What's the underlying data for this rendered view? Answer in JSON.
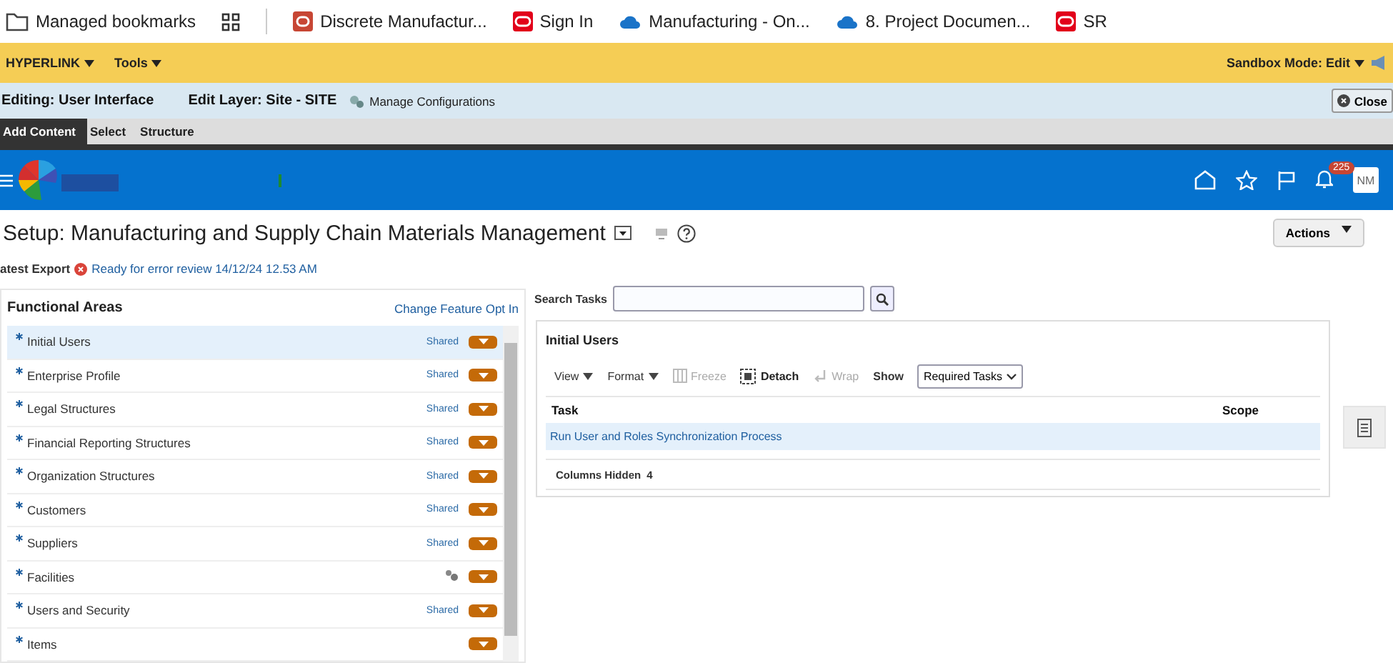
{
  "bookmarks": [
    {
      "kind": "folder",
      "label": "Managed bookmarks"
    },
    {
      "kind": "apps"
    },
    {
      "kind": "redsquare",
      "label": "Discrete Manufactur..."
    },
    {
      "kind": "oracle",
      "label": "Sign In"
    },
    {
      "kind": "cloud",
      "label": "Manufacturing - On..."
    },
    {
      "kind": "cloud",
      "label": "8. Project Documen..."
    },
    {
      "kind": "oracle",
      "label": "SR"
    }
  ],
  "menu_bar": {
    "menus": [
      "HYPERLINK",
      "Tools"
    ],
    "sandbox": "Sandbox Mode: Edit"
  },
  "edit_bar": {
    "editing": "Editing: User Interface",
    "layer": "Edit Layer: Site - SITE",
    "manage": "Manage Configurations",
    "close": "Close"
  },
  "composer_tabs": [
    {
      "label": "Add Content",
      "selected": true
    },
    {
      "label": "Select",
      "selected": false
    },
    {
      "label": "Structure",
      "selected": false
    }
  ],
  "header": {
    "notifications": "225",
    "avatar": "NM"
  },
  "page": {
    "title": "Setup: Manufacturing and Supply Chain Materials Management",
    "actions": "Actions",
    "export_label": "atest Export",
    "export_status": "Ready for error review 14/12/24 12.53 AM"
  },
  "functional_areas": {
    "title": "Functional Areas",
    "link": "Change Feature Opt In",
    "items": [
      {
        "label": "Initial Users",
        "required": true,
        "kind": "shared",
        "status": "Shared",
        "selected": true
      },
      {
        "label": "Enterprise Profile",
        "required": true,
        "kind": "shared",
        "status": "Shared",
        "selected": false
      },
      {
        "label": "Legal Structures",
        "required": true,
        "kind": "shared",
        "status": "Shared",
        "selected": false
      },
      {
        "label": "Financial Reporting Structures",
        "required": true,
        "kind": "shared",
        "status": "Shared",
        "selected": false
      },
      {
        "label": "Organization Structures",
        "required": true,
        "kind": "shared",
        "status": "Shared",
        "selected": false
      },
      {
        "label": "Customers",
        "required": true,
        "kind": "shared",
        "status": "Shared",
        "selected": false
      },
      {
        "label": "Suppliers",
        "required": true,
        "kind": "shared",
        "status": "Shared",
        "selected": false
      },
      {
        "label": "Facilities",
        "required": true,
        "kind": "gear",
        "selected": false
      },
      {
        "label": "Users and Security",
        "required": true,
        "kind": "shared",
        "status": "Shared",
        "selected": false
      },
      {
        "label": "Items",
        "required": true,
        "kind": "none",
        "selected": false
      }
    ]
  },
  "tasks": {
    "search_label": "Search Tasks",
    "panel_title": "Initial Users",
    "toolbar": [
      {
        "kind": "menu",
        "label": "View",
        "disabled": false
      },
      {
        "kind": "menu",
        "label": "Format",
        "disabled": false
      },
      {
        "kind": "freeze",
        "label": "Freeze",
        "disabled": true
      },
      {
        "kind": "detach",
        "label": "Detach",
        "disabled": false
      },
      {
        "kind": "wrap",
        "label": "Wrap",
        "disabled": true
      }
    ],
    "show_label": "Show",
    "show_value": "Required Tasks",
    "columns": [
      "Task",
      "Scope"
    ],
    "rows": [
      {
        "task": "Run User and Roles Synchronization Process",
        "selected": true
      }
    ],
    "hidden_label": "Columns Hidden",
    "hidden_count": "4"
  }
}
